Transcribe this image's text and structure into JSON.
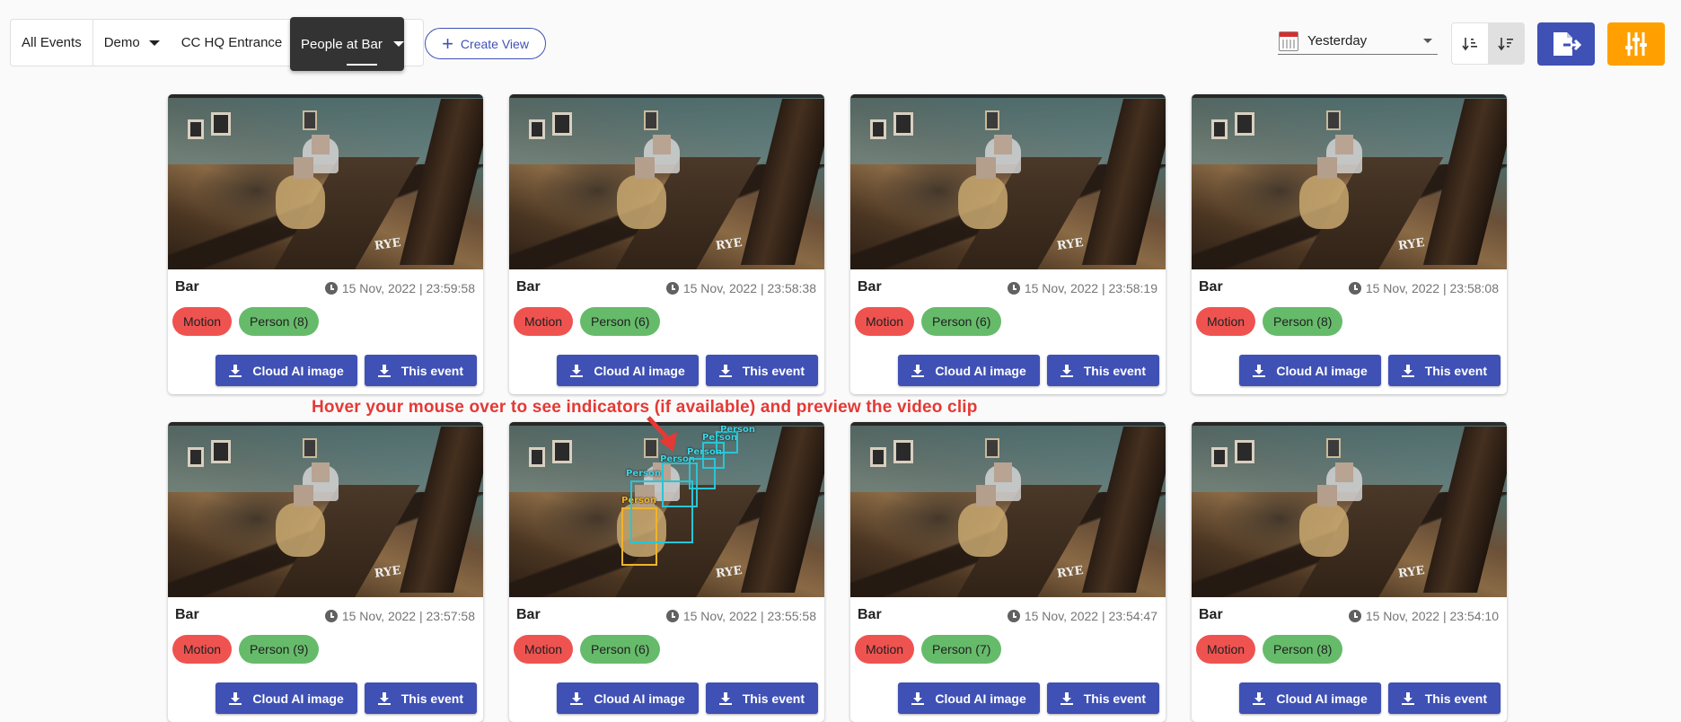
{
  "header": {
    "tabs": [
      {
        "label": "All Events",
        "dropdown": false
      },
      {
        "label": "Demo",
        "dropdown": true
      },
      {
        "label": "CC HQ Entrance",
        "dropdown": true
      }
    ],
    "active_tab": {
      "label": "People at Bar",
      "dropdown": true
    },
    "create_view_label": "Create View",
    "date_range": "Yesterday",
    "colors": {
      "primary": "#3f51b5",
      "accent": "#ffa000",
      "motion": "#ef5350",
      "person": "#66bb6a"
    }
  },
  "hint": "Hover your mouse over to see indicators (if available) and preview the video clip",
  "events": [
    {
      "title": "Bar",
      "time": "15 Nov, 2022 | 23:59:58",
      "tags": [
        "Motion",
        "Person (8)"
      ],
      "buttons": [
        "Cloud AI image",
        "This event"
      ]
    },
    {
      "title": "Bar",
      "time": "15 Nov, 2022 | 23:58:38",
      "tags": [
        "Motion",
        "Person (6)"
      ],
      "buttons": [
        "Cloud AI image",
        "This event"
      ]
    },
    {
      "title": "Bar",
      "time": "15 Nov, 2022 | 23:58:19",
      "tags": [
        "Motion",
        "Person (6)"
      ],
      "buttons": [
        "Cloud AI image",
        "This event"
      ]
    },
    {
      "title": "Bar",
      "time": "15 Nov, 2022 | 23:58:08",
      "tags": [
        "Motion",
        "Person (8)"
      ],
      "buttons": [
        "Cloud AI image",
        "This event"
      ]
    },
    {
      "title": "Bar",
      "time": "15 Nov, 2022 | 23:57:58",
      "tags": [
        "Motion",
        "Person (9)"
      ],
      "buttons": [
        "Cloud AI image",
        "This event"
      ]
    },
    {
      "title": "Bar",
      "time": "15 Nov, 2022 | 23:55:58",
      "tags": [
        "Motion",
        "Person (6)"
      ],
      "buttons": [
        "Cloud AI image",
        "This event"
      ],
      "detections": [
        "Person",
        "Person",
        "Person",
        "Person",
        "Person",
        "Person"
      ]
    },
    {
      "title": "Bar",
      "time": "15 Nov, 2022 | 23:54:47",
      "tags": [
        "Motion",
        "Person (7)"
      ],
      "buttons": [
        "Cloud AI image",
        "This event"
      ]
    },
    {
      "title": "Bar",
      "time": "15 Nov, 2022 | 23:54:10",
      "tags": [
        "Motion",
        "Person (8)"
      ],
      "buttons": [
        "Cloud AI image",
        "This event"
      ]
    }
  ],
  "thumb_text": "RYE"
}
